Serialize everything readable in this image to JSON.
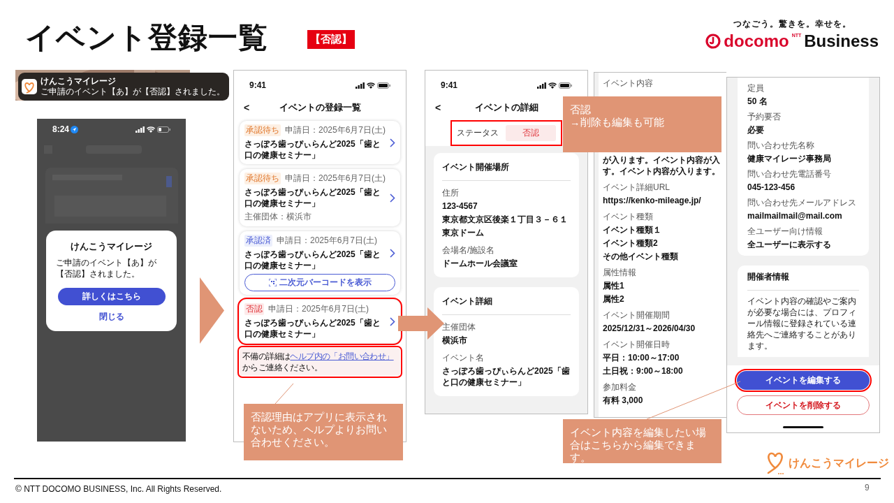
{
  "slide": {
    "title": "イベント登録一覧",
    "badge": "【否認】",
    "tagline": "つなごう。驚きを。幸せを。",
    "logo_superscript": "NTT",
    "logo_brand": "docomo",
    "logo_word": "Business",
    "footer_logo": "けんこうマイレージ",
    "copyright": "© NTT DOCOMO BUSINESS, Inc. All Rights Reserved.",
    "page_number": "9"
  },
  "notification": {
    "app": "けんこうマイレージ",
    "message": "ご申請のイベント【あ】が【否認】されました。"
  },
  "alert_screen": {
    "time": "8:24",
    "dialog": {
      "title": "けんこうマイレージ",
      "message": "ご申請のイベント【あ】が【否認】されました。",
      "primary_button": "詳しくはこちら",
      "close_link": "閉じる"
    }
  },
  "list_screen": {
    "time": "9:41",
    "back": "<",
    "title": "イベントの登録一覧",
    "cards": [
      {
        "status": "承認待ち",
        "kind": "pending",
        "date": "申請日：2025年6月7日(土)",
        "title": "さっぽろ歯っぴぃらんど2025「歯と口の健康セミナー」",
        "highlighted": false
      },
      {
        "status": "承認待ち",
        "kind": "pending",
        "date": "申請日：2025年6月7日(土)",
        "title": "さっぽろ歯っぴぃらんど2025「歯と口の健康セミナー」",
        "organizer": "主催団体：横浜市",
        "highlighted": false
      },
      {
        "status": "承認済",
        "kind": "approved",
        "date": "申請日：2025年6月7日(土)",
        "title": "さっぽろ歯っぴぃらんど2025「歯と口の健康セミナー」",
        "qr_button": "二次元バーコードを表示",
        "highlighted": false
      },
      {
        "status": "否認",
        "kind": "rejected",
        "date": "申請日：2025年6月7日(土)",
        "title": "さっぽろ歯っぴぃらんど2025「歯と口の健康セミナー」",
        "highlighted": true,
        "note": {
          "before": "不備の詳細は",
          "link": "ヘルプ内の「お問い合わせ」",
          "after": "からご連絡ください。",
          "highlighted": true
        }
      }
    ]
  },
  "detail_screen": {
    "time": "9:41",
    "back": "<",
    "title": "イベントの詳細",
    "status_label": "ステータス",
    "status": "否認",
    "status_highlighted": true,
    "sections": [
      {
        "heading": "イベント開催場所",
        "fields": [
          {
            "label": "住所",
            "values": [
              "123-4567",
              "東京都文京区後楽１丁目３－６１",
              "東京ドーム"
            ]
          },
          {
            "label": "会場名/施設名",
            "values": [
              "ドームホール会議室"
            ]
          }
        ]
      },
      {
        "heading": "イベント詳細",
        "fields": [
          {
            "label": "主催団体",
            "values": [
              "横浜市"
            ]
          },
          {
            "label": "イベント名",
            "values": [
              "さっぽろ歯っぴぃらんど2025「歯と口の健康セミナー」"
            ]
          }
        ]
      }
    ]
  },
  "detail_scroll_screen": {
    "first_label": "イベント内容",
    "content_lines": [
      "が入ります。イベント内容が入",
      "す。イベント内容が入ります。"
    ],
    "fields": [
      {
        "label": "イベント詳細URL",
        "values": [
          "https://kenko-mileage.jp/"
        ]
      },
      {
        "label": "イベント種類",
        "values": [
          "イベント種類１",
          "イベント種類2",
          "その他イベント種類"
        ]
      },
      {
        "label": "属性情報",
        "values": [
          "属性1",
          "属性2"
        ]
      },
      {
        "label": "イベント開催期間",
        "values": [
          "2025/12/31～2026/04/30"
        ]
      },
      {
        "label": "イベント開催日時",
        "values": [
          "平日：10:00～17:00",
          "土日祝：9:00～18:00"
        ]
      },
      {
        "label": "参加料金",
        "values": [
          "有料 3,000"
        ]
      }
    ]
  },
  "detail_bottom_screen": {
    "fields": [
      {
        "label": "定員",
        "values": [
          "50 名"
        ]
      },
      {
        "label": "予約要否",
        "values": [
          "必要"
        ]
      },
      {
        "label": "問い合わせ先名称",
        "values": [
          "健康マイレージ事務局"
        ]
      },
      {
        "label": "問い合わせ先電話番号",
        "values": [
          "045-123-456"
        ]
      },
      {
        "label": "問い合わせ先メールアドレス",
        "values": [
          "mailmailmail@mail.com"
        ]
      },
      {
        "label": "全ユーザー向け情報",
        "values": [
          "全ユーザーに表示する"
        ]
      }
    ],
    "organizer_heading": "開催者情報",
    "organizer_text": "イベント内容の確認やご案内が必要な場合には、プロフィール情報に登録されている連絡先へご連絡することがあります。",
    "edit_button": "イベントを編集する",
    "edit_highlighted": true,
    "delete_button": "イベントを削除する"
  },
  "callouts": [
    {
      "lines": [
        "否認理由はアプリに表示されないため、ヘルプよりお問い合わせください。"
      ]
    },
    {
      "lines": [
        "否認",
        "→削除も編集も可能"
      ]
    },
    {
      "lines": [
        "イベント内容を編集したい場合はこちらから編集できます。"
      ]
    }
  ]
}
